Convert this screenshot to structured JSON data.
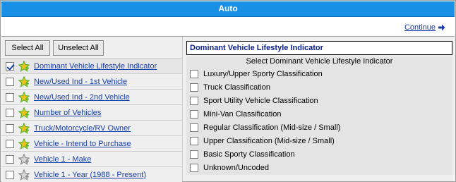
{
  "window": {
    "title": "Auto"
  },
  "nav": {
    "continue_label": "Continue"
  },
  "toolbar": {
    "select_all_label": "Select All",
    "unselect_all_label": "Unselect All"
  },
  "variables": [
    {
      "label": "Dominant Vehicle Lifestyle Indicator",
      "checked": true,
      "icon": "star-green-icon"
    },
    {
      "label": "New/Used Ind - 1st Vehicle",
      "checked": false,
      "icon": "star-green-icon"
    },
    {
      "label": "New/Used Ind - 2nd Vehicle",
      "checked": false,
      "icon": "star-green-icon"
    },
    {
      "label": "Number of Vehicles",
      "checked": false,
      "icon": "star-green-icon"
    },
    {
      "label": "Truck/Motorcycle/RV Owner",
      "checked": false,
      "icon": "star-green-icon"
    },
    {
      "label": "Vehicle - Intend to Purchase",
      "checked": false,
      "icon": "star-green-icon"
    },
    {
      "label": "Vehicle 1 - Make",
      "checked": false,
      "icon": "star-gray-icon"
    },
    {
      "label": "Vehicle 1 - Year (1988 - Present)",
      "checked": false,
      "icon": "star-gray-icon"
    }
  ],
  "detail": {
    "title": "Dominant Vehicle Lifestyle Indicator",
    "subtitle": "Select Dominant Vehicle Lifestyle Indicator",
    "options": [
      {
        "label": "Luxury/Upper Sporty Classification",
        "checked": false
      },
      {
        "label": "Truck Classification",
        "checked": false
      },
      {
        "label": "Sport Utility Vehicle Classification",
        "checked": false
      },
      {
        "label": "Mini-Van Classification",
        "checked": false
      },
      {
        "label": "Regular Classification (Mid-size / Small)",
        "checked": false
      },
      {
        "label": "Upper Classification (Mid-size / Small)",
        "checked": false
      },
      {
        "label": "Basic Sporty Classification",
        "checked": false
      },
      {
        "label": "Unknown/Uncoded",
        "checked": false
      }
    ]
  },
  "colors": {
    "titlebar": "#1a8fe6",
    "link": "#1a3fa8",
    "detail_title": "#0a1f8f",
    "star_green": "#5ab52a",
    "star_yellow": "#f2c21a",
    "star_gray": "#8c8c8c"
  }
}
